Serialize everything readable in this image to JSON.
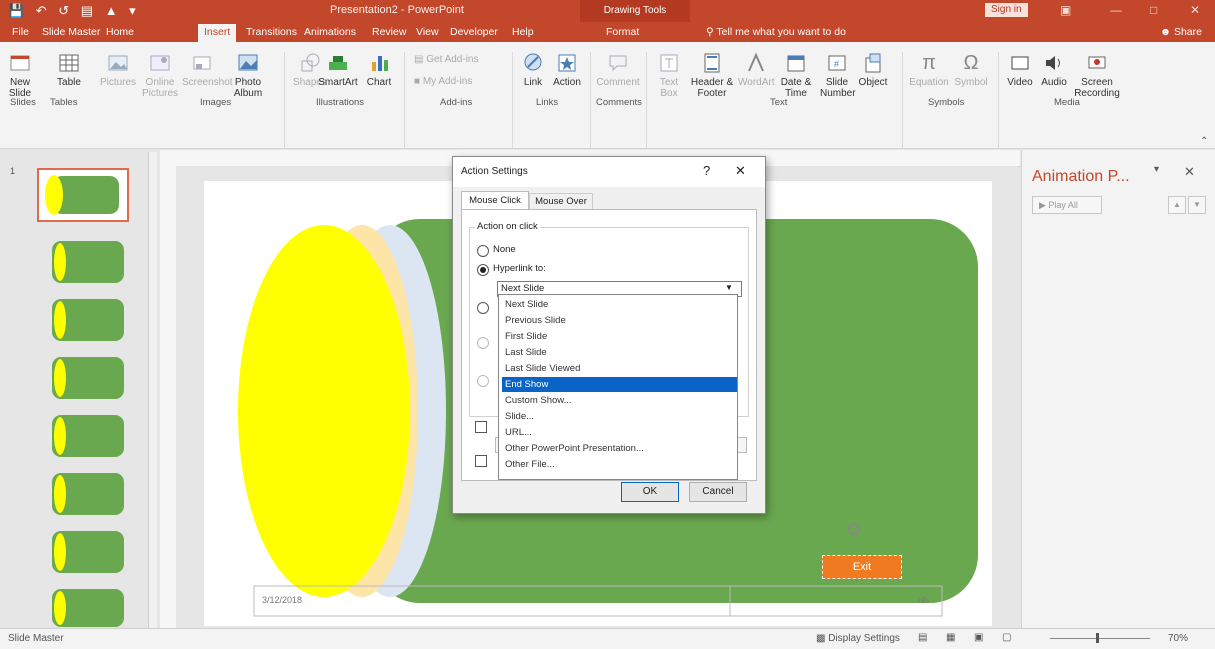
{
  "titlebar": {
    "title": "Presentation2 - PowerPoint",
    "context_tab": "Drawing Tools",
    "sign_in": "Sign in"
  },
  "tabs": {
    "file": "File",
    "slide_master": "Slide Master",
    "home": "Home",
    "insert": "Insert",
    "transitions": "Transitions",
    "animations": "Animations",
    "review": "Review",
    "view": "View",
    "developer": "Developer",
    "help": "Help",
    "format": "Format",
    "tell_me": "Tell me what you want to do",
    "share": "Share"
  },
  "ribbon": {
    "new_slide": "New Slide",
    "table": "Table",
    "pictures": "Pictures",
    "online_pictures": "Online Pictures",
    "screenshot": "Screenshot",
    "photo_album": "Photo Album",
    "shapes": "Shapes",
    "smartart": "SmartArt",
    "chart": "Chart",
    "get_addins": "Get Add-ins",
    "my_addins": "My Add-ins",
    "link": "Link",
    "action": "Action",
    "comment": "Comment",
    "text_box": "Text Box",
    "header_footer": "Header & Footer",
    "wordart": "WordArt",
    "date_time": "Date & Time",
    "slide_number": "Slide Number",
    "object": "Object",
    "equation": "Equation",
    "symbol": "Symbol",
    "video": "Video",
    "audio": "Audio",
    "screen_recording": "Screen Recording",
    "groups": {
      "slides": "Slides",
      "tables": "Tables",
      "images": "Images",
      "illustrations": "Illustrations",
      "addins": "Add-ins",
      "links": "Links",
      "comments": "Comments",
      "text": "Text",
      "symbols": "Symbols",
      "media": "Media"
    }
  },
  "animation_pane": {
    "title": "Animation P...",
    "play_all": "Play All"
  },
  "slide": {
    "footer_date": "3/12/2018",
    "page_number": "‹#›",
    "exit_button": "Exit"
  },
  "dialog": {
    "title": "Action Settings",
    "help": "?",
    "close": "✕",
    "tab_mouse_click": "Mouse Click",
    "tab_mouse_over": "Mouse Over",
    "section_label": "Action on click",
    "none_label": "None",
    "hyperlink_label": "Hyperlink to:",
    "hyperlink_value": "Next Slide",
    "options": [
      "Next Slide",
      "Previous Slide",
      "First Slide",
      "Last Slide",
      "Last Slide Viewed",
      "End Show",
      "Custom Show...",
      "Slide...",
      "URL...",
      "Other PowerPoint Presentation...",
      "Other File..."
    ],
    "selected_option": "End Show",
    "ok": "OK",
    "cancel": "Cancel"
  },
  "status": {
    "slide_master": "Slide Master",
    "display_settings": "Display Settings",
    "zoom": "70%"
  },
  "colors": {
    "accent": "#c3472a",
    "slide_green": "#6aa84f",
    "yellow": "#ffff00",
    "peach": "#fde4a7",
    "light_blue": "#dce6f2",
    "exit_orange": "#f07a1f",
    "selection_blue": "#0a64c8"
  }
}
